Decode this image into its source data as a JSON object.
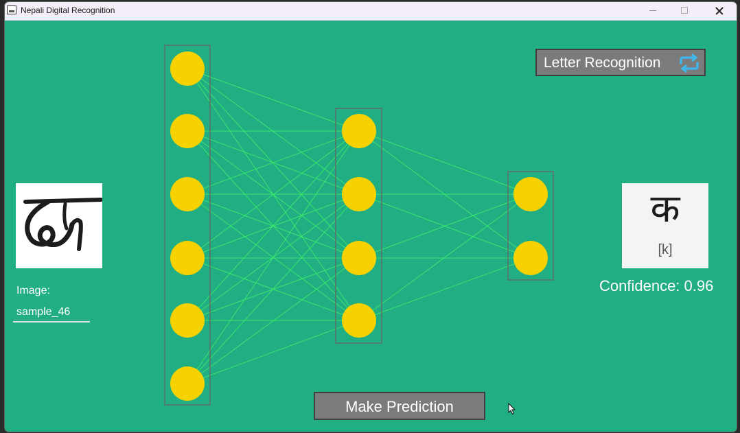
{
  "window": {
    "title": "Nepali Digital Recognition"
  },
  "colors": {
    "background": "#21ae82",
    "node": "#f7d200",
    "edge": "#3ef06a",
    "button": "#7b7b7b",
    "layer_border": "#5f6f69"
  },
  "network": {
    "layers": [
      6,
      4,
      2
    ]
  },
  "input": {
    "image_label": "Image:",
    "sample_name": "sample_46"
  },
  "mode_toggle": {
    "label": "Letter Recognition",
    "icon": "repeat-icon"
  },
  "prediction": {
    "character": "क",
    "romanization": "[k]",
    "confidence_text": "Confidence: 0.96"
  },
  "actions": {
    "predict_label": "Make Prediction"
  }
}
